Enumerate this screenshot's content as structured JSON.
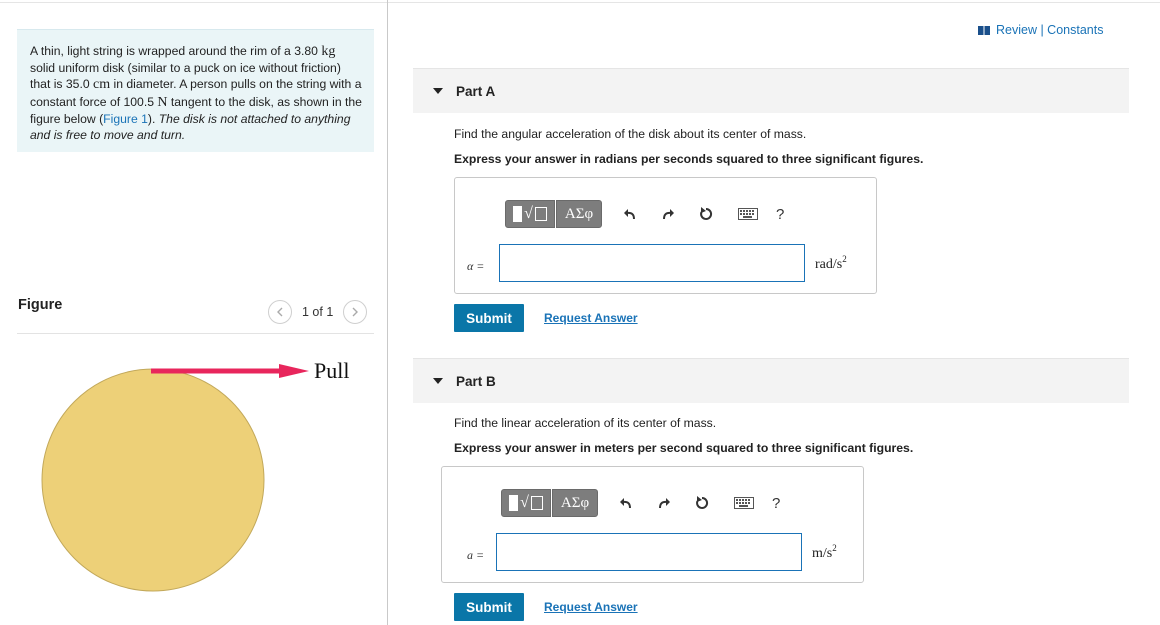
{
  "header": {
    "review_link": "Review | Constants"
  },
  "problem": {
    "text_1": "A thin, light string is wrapped around the rim of a 3.80 ",
    "unit_kg": "kg",
    "text_2": " solid uniform disk (similar to a puck on ice without friction) that is 35.0 ",
    "unit_cm": "cm",
    "text_3": " in diameter. A person pulls on the string with a constant force of 100.5 ",
    "unit_N": "N",
    "text_4": " tangent to the disk, as shown in the figure below (",
    "figure_link": "Figure 1",
    "text_5": "). ",
    "italic_note": "The disk is not attached to anything and is free to move and turn."
  },
  "figure": {
    "label": "Figure",
    "pager_count": "1 of 1",
    "prev_icon": "chevron-left-icon",
    "next_icon": "chevron-right-icon",
    "pull_label": "Pull",
    "disk_color": "#edd078",
    "arrow_color": "#e8265c"
  },
  "parts": [
    {
      "title": "Part A",
      "question": "Find the angular acceleration of the disk about its center of mass.",
      "instruction": "Express your answer in radians per seconds squared to three significant figures.",
      "variable": "α =",
      "unit_base": "rad/s",
      "unit_exp": "2",
      "input_value": "",
      "submit_label": "Submit",
      "request_label": "Request Answer"
    },
    {
      "title": "Part B",
      "question": "Find the linear acceleration of its center of mass.",
      "instruction": "Express your answer in meters per second squared to three significant figures.",
      "variable": "a =",
      "unit_base": "m/s",
      "unit_exp": "2",
      "input_value": "",
      "submit_label": "Submit",
      "request_label": "Request Answer"
    }
  ],
  "toolbar": {
    "templates_icon": "templates-icon",
    "greek_label": "ΑΣφ",
    "undo_icon": "undo-icon",
    "redo_icon": "redo-icon",
    "reset_icon": "reset-icon",
    "keyboard_icon": "keyboard-icon",
    "help_label": "?"
  },
  "colors": {
    "accent": "#1a73b7",
    "submit": "#0a76a8",
    "problem_bg": "#eaf5f7"
  }
}
